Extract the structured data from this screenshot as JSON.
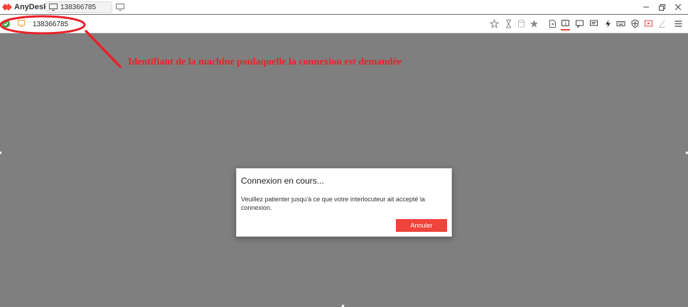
{
  "titlebar": {
    "app_name": "AnyDesk",
    "tab_label": "138366785"
  },
  "addressbar": {
    "input_value": "138366785",
    "status": "connected-check",
    "toolbar_icons": [
      "star-outline-icon",
      "hourglass-icon",
      "database-icon",
      "star-icon",
      "file-transfer-icon",
      "monitor-icon",
      "chat-icon",
      "comment-icon",
      "lightning-icon",
      "keyboard-icon",
      "shield-icon",
      "record-icon",
      "pen-icon",
      "menu-icon"
    ]
  },
  "annotation": {
    "text": "Identifiant de la machine poulaquelle la connexion est demandée"
  },
  "dialog": {
    "title": "Connexion en cours...",
    "message": "Veuillez patienter jusqu'à ce que votre interlocuteur ait accepté la connexion.",
    "cancel_label": "Annuler"
  },
  "colors": {
    "accent": "#ef443b",
    "annotation": "#e8222a",
    "background": "#7f7f7f"
  }
}
